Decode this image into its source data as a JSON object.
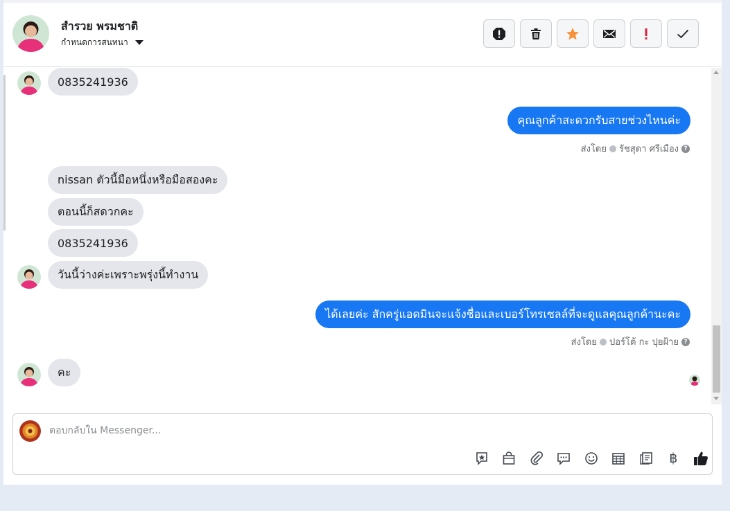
{
  "header": {
    "contact_name": "สำรวย พรมชาติ",
    "assign_label": "กำหนดการสนทนา",
    "actions": [
      {
        "name": "report-spam-icon",
        "title": "spam"
      },
      {
        "name": "trash-icon",
        "title": "delete"
      },
      {
        "name": "star-icon",
        "title": "star"
      },
      {
        "name": "envelope-icon",
        "title": "mark unread"
      },
      {
        "name": "exclamation-icon",
        "title": "follow up"
      },
      {
        "name": "checkmark-icon",
        "title": "done"
      }
    ]
  },
  "thread": {
    "messages": [
      {
        "dir": "in",
        "text": "0835241936"
      },
      {
        "dir": "out",
        "text": "คุณลูกค้าสะดวกรับสายช่วงไหนค่ะ",
        "sent_by_prefix": "ส่งโดย",
        "sender": "รัชสุดา ศรีเมือง"
      },
      {
        "dir": "in",
        "text": "nissan ตัวนี้มือหนึ่งหรือมือสองคะ"
      },
      {
        "dir": "in",
        "text": "ตอนนี้ก็สดวกคะ"
      },
      {
        "dir": "in",
        "text": "0835241936"
      },
      {
        "dir": "in",
        "text": "วันนี้ว่างค่ะเพราะพรุ่งนี้ทำงาน"
      },
      {
        "dir": "out",
        "text": "ได้เลยค่ะ สักครู่แอดมินจะแจ้งชื่อและเบอร์โทรเซลล์ที่จะดูแลคุณลูกค้านะคะ",
        "sent_by_prefix": "ส่งโดย",
        "sender": "ปอร์โต้ กะ ปุยฝ้าย"
      },
      {
        "dir": "in",
        "text": "คะ"
      }
    ]
  },
  "composer": {
    "placeholder": "ตอบกลับใน Messenger...",
    "tools": [
      "saved-reply-icon",
      "shopping-bag-icon",
      "paperclip-icon",
      "chat-bubble-icon",
      "emoji-icon",
      "calendar-icon",
      "notes-icon",
      "baht-icon",
      "thumbs-up-icon"
    ],
    "baht_symbol": "฿"
  },
  "colors": {
    "outgoing_bubble": "#1877f2",
    "incoming_bubble": "#e4e6eb",
    "star": "#f7923a",
    "exclamation": "#e41e3f"
  }
}
